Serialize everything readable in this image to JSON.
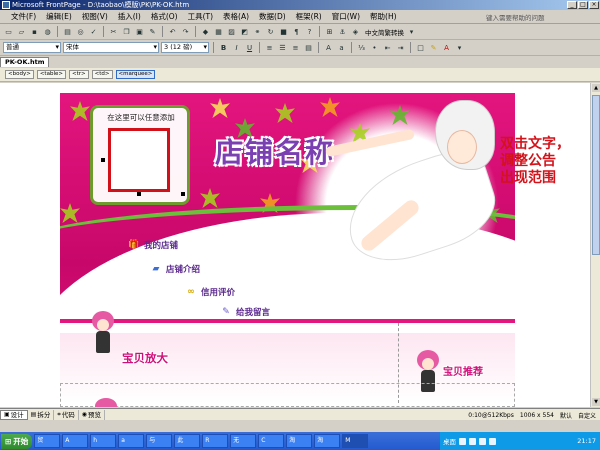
{
  "window": {
    "title": "Microsoft FrontPage - D:\\taobao\\模版\\PK\\PK-OK.htm",
    "buttons": [
      "_",
      "□",
      "×"
    ]
  },
  "menu": {
    "items": [
      "文件(F)",
      "编辑(E)",
      "视图(V)",
      "插入(I)",
      "格式(O)",
      "工具(T)",
      "表格(A)",
      "数据(D)",
      "框架(R)",
      "窗口(W)",
      "帮助(H)"
    ],
    "help_placeholder": "键入需要帮助的问题"
  },
  "toolbar": {
    "style_value": "普通",
    "font_value": "宋体",
    "size_value": "3 (12 磅)",
    "convert_label": "中文简繁转换",
    "bold": "B",
    "italic": "I",
    "underline": "U",
    "icons": {
      "row1": [
        "new-icon",
        "open-icon",
        "save-icon",
        "publish-icon",
        "print-icon",
        "preview-icon",
        "spell-icon",
        "cut-icon",
        "copy-icon",
        "paste-icon",
        "format-painter-icon",
        "undo-icon",
        "redo-icon",
        "insert-component-icon",
        "insert-table-icon",
        "insert-picture-icon",
        "drawing-icon",
        "hyperlink-icon",
        "refresh-icon",
        "stop-icon",
        "show-all-icon",
        "help-icon"
      ],
      "row2": [
        "align-left-icon",
        "align-center-icon",
        "align-right-icon",
        "justify-icon",
        "increase-font-icon",
        "decrease-font-icon",
        "numbering-icon",
        "bullets-icon",
        "decrease-indent-icon",
        "increase-indent-icon",
        "border-icon",
        "highlight-icon",
        "font-color-icon"
      ]
    }
  },
  "document": {
    "tab_label": "PK-OK.htm",
    "tags": [
      "<body>",
      "<table>",
      "<tr>",
      "<td>",
      "<marquee>"
    ]
  },
  "page": {
    "frame_caption": "在这里可以任意添加",
    "shop_name": "店铺名称",
    "nav": [
      {
        "label": "我的店铺",
        "icon": "gift-icon"
      },
      {
        "label": "店铺介绍",
        "icon": "book-icon"
      },
      {
        "label": "信用评价",
        "icon": "glasses-icon"
      },
      {
        "label": "给我留言",
        "icon": "pen-icon"
      }
    ],
    "section_left": "宝贝放大",
    "section_right": "宝贝推荐",
    "instruction": [
      "双击文字，",
      "调整公告",
      "出现范围"
    ]
  },
  "views": {
    "tabs": [
      {
        "label": "设计",
        "icon": "design-icon"
      },
      {
        "label": "拆分",
        "icon": "split-icon"
      },
      {
        "label": "代码",
        "icon": "code-icon"
      },
      {
        "label": "预览",
        "icon": "preview-view-icon"
      }
    ],
    "status": [
      "0:10@512Kbps",
      "1006 x 554",
      "默认",
      "自定义"
    ]
  },
  "taskbar": {
    "start": "开始",
    "items": [
      "贸",
      "A",
      "h",
      "a",
      "与",
      "此",
      "R",
      "无",
      "C",
      "淘",
      "淘",
      "M"
    ],
    "tray_label": "桌面",
    "clock": "21:17"
  },
  "colors": {
    "magenta": "#e3157e",
    "purple": "#7a3fb0",
    "red": "#d3121a",
    "green": "#6cbf3a"
  }
}
